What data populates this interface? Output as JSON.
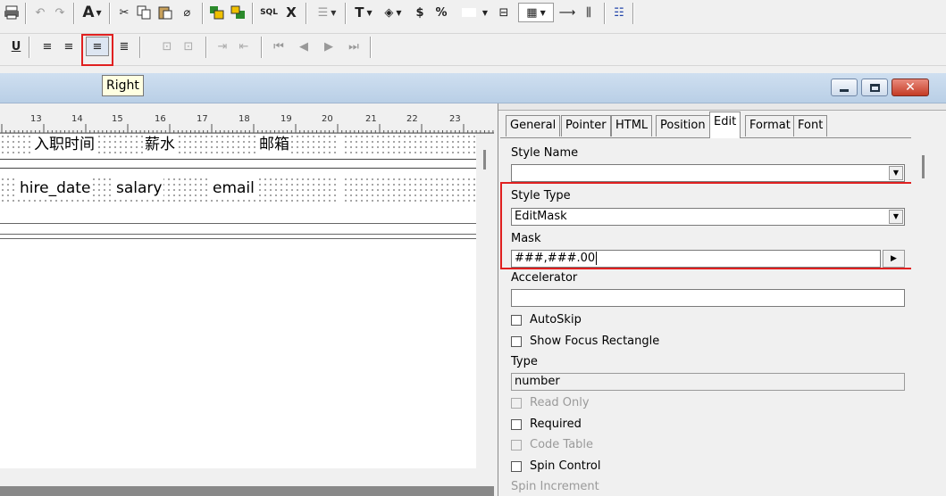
{
  "toolbar1": {
    "icons": [
      "print-icon",
      "undo-icon",
      "redo-icon",
      "font-icon",
      "cut-icon",
      "copy-icon",
      "paste-icon",
      "eraser-icon",
      "bring-to-front-icon",
      "send-to-back-icon",
      "sql-icon",
      "delete-icon",
      "align-icon",
      "text-icon",
      "paint-icon",
      "currency-icon",
      "percent-icon",
      "color-dropdown",
      "border-icon",
      "grid-icon",
      "arrow-icon",
      "columns-icon",
      "layout-icon"
    ],
    "sql_label": "SQL",
    "x_label": "X",
    "currency_label": "$",
    "percent_label": "%"
  },
  "toolbar2": {
    "underline_label": "U",
    "tooltip": "Right"
  },
  "ruler": {
    "labels": [
      "13",
      "14",
      "15",
      "16",
      "17",
      "18",
      "19",
      "20",
      "21",
      "22",
      "23"
    ]
  },
  "report": {
    "headers": [
      "入职时间",
      "薪水",
      "邮箱"
    ],
    "fields": [
      "hire_date",
      "salary",
      "email"
    ]
  },
  "properties": {
    "tabs": [
      "General",
      "Pointer",
      "HTML",
      "Position",
      "Edit",
      "Format",
      "Font"
    ],
    "active_tab": "Edit",
    "style_name_label": "Style Name",
    "style_name_value": "",
    "style_type_label": "Style Type",
    "style_type_value": "EditMask",
    "mask_label": "Mask",
    "mask_value": "###,###.00",
    "accelerator_label": "Accelerator",
    "accelerator_value": "",
    "autoskip_label": "AutoSkip",
    "show_focus_label": "Show Focus Rectangle",
    "type_label": "Type",
    "type_value": "number",
    "read_only_label": "Read Only",
    "required_label": "Required",
    "code_table_label": "Code Table",
    "spin_control_label": "Spin Control",
    "spin_increment_label": "Spin Increment"
  },
  "colors": {
    "highlight": "#e02020",
    "titlebar": "#c4d6eb",
    "close_button": "#d8432f"
  }
}
